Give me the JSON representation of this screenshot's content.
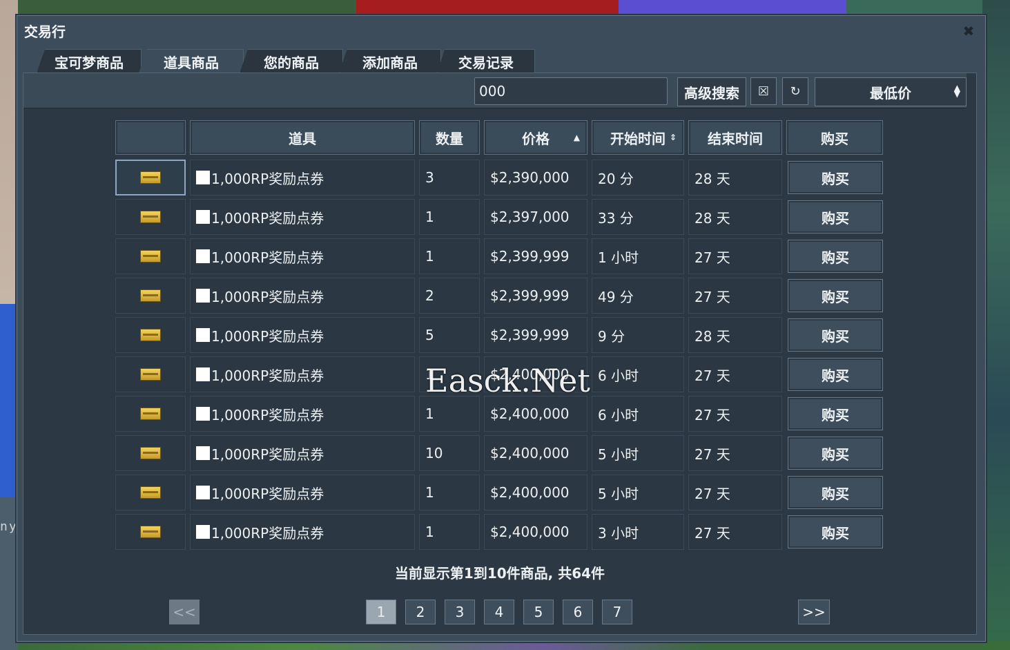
{
  "window": {
    "title": "交易行",
    "close_icon": "✖"
  },
  "tabs": [
    "宝可梦商品",
    "道具商品",
    "您的商品",
    "添加商品",
    "交易记录"
  ],
  "toolbar": {
    "search_value": "000",
    "advanced_label": "高级搜索",
    "clear_icon": "☒",
    "refresh_icon": "↻",
    "sort_value": "最低价"
  },
  "table": {
    "headers": [
      "",
      "道具",
      "数量",
      "价格",
      "开始时间",
      "结束时间",
      "购买"
    ],
    "price_sort_icon": "▲",
    "start_sort_icon": "⇕",
    "buy_label": "购买",
    "rows": [
      {
        "item": "1,000RP奖励点券",
        "qty": "3",
        "price": "$2,390,000",
        "start": "20 分",
        "end": "28 天"
      },
      {
        "item": "1,000RP奖励点券",
        "qty": "1",
        "price": "$2,397,000",
        "start": "33 分",
        "end": "28 天"
      },
      {
        "item": "1,000RP奖励点券",
        "qty": "1",
        "price": "$2,399,999",
        "start": "1 小时",
        "end": "27 天"
      },
      {
        "item": "1,000RP奖励点券",
        "qty": "2",
        "price": "$2,399,999",
        "start": "49 分",
        "end": "27 天"
      },
      {
        "item": "1,000RP奖励点券",
        "qty": "5",
        "price": "$2,399,999",
        "start": "9 分",
        "end": "28 天"
      },
      {
        "item": "1,000RP奖励点券",
        "qty": "1",
        "price": "$2,400,000",
        "start": "6 小时",
        "end": "27 天"
      },
      {
        "item": "1,000RP奖励点券",
        "qty": "1",
        "price": "$2,400,000",
        "start": "6 小时",
        "end": "27 天"
      },
      {
        "item": "1,000RP奖励点券",
        "qty": "10",
        "price": "$2,400,000",
        "start": "5 小时",
        "end": "27 天"
      },
      {
        "item": "1,000RP奖励点券",
        "qty": "1",
        "price": "$2,400,000",
        "start": "5 小时",
        "end": "27 天"
      },
      {
        "item": "1,000RP奖励点券",
        "qty": "1",
        "price": "$2,400,000",
        "start": "3 小时",
        "end": "27 天"
      }
    ]
  },
  "watermark": "Easck.Net",
  "status_text": "当前显示第1到10件商品, 共64件",
  "pager": {
    "prev_label": "<<",
    "next_label": ">>",
    "pages": [
      "1",
      "2",
      "3",
      "4",
      "5",
      "6",
      "7"
    ],
    "current_page": "1"
  },
  "background": {
    "side_text": "ny"
  }
}
